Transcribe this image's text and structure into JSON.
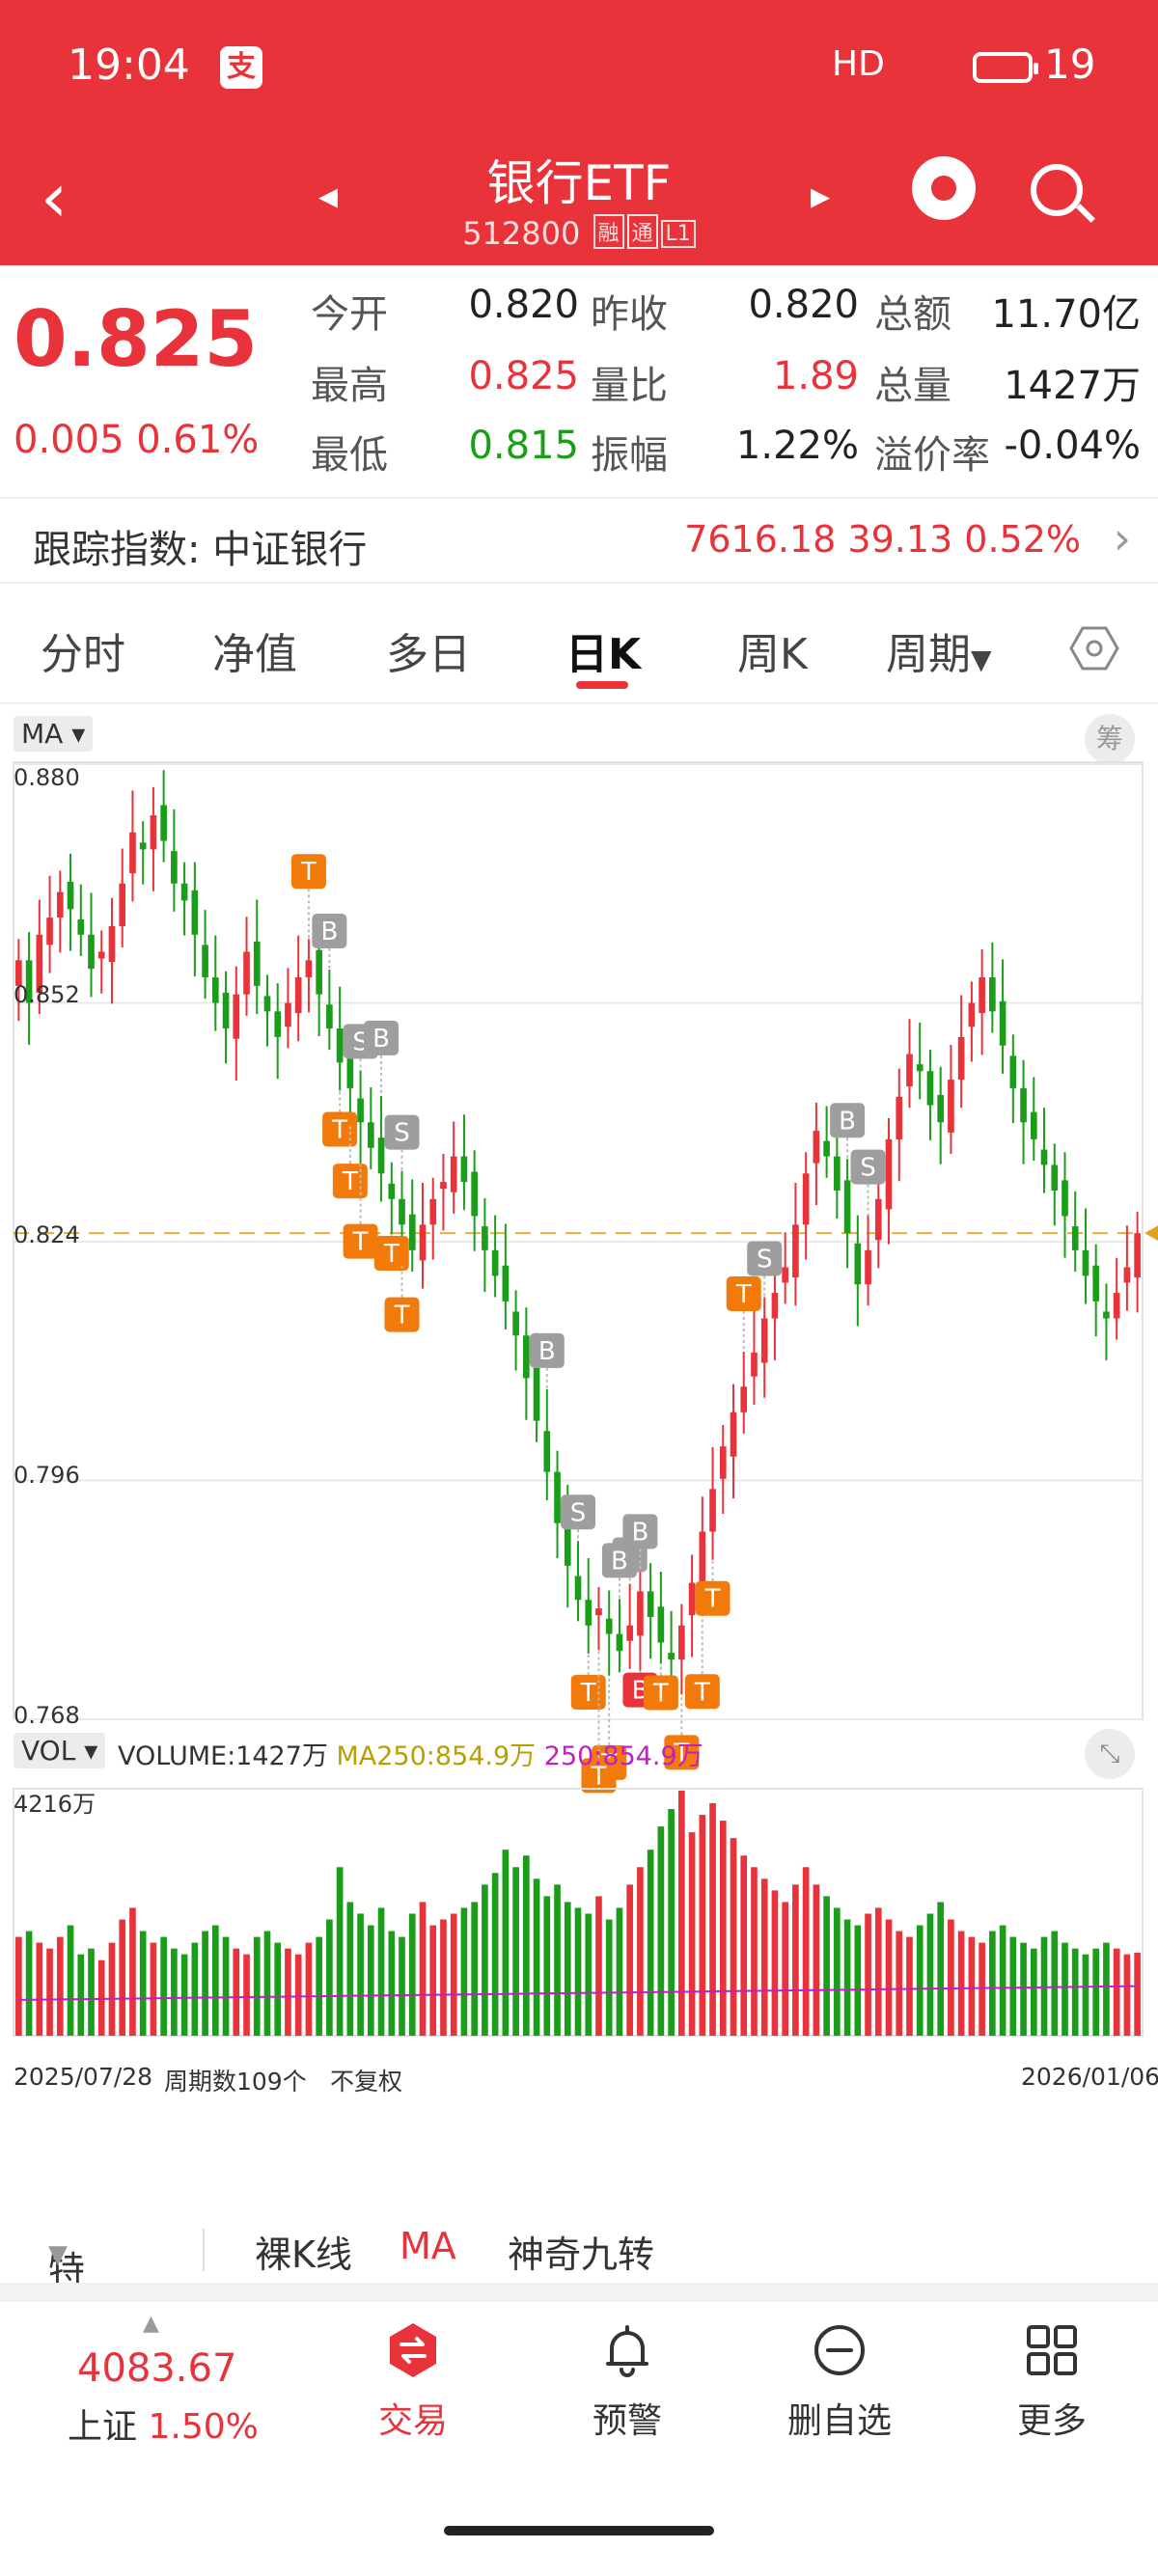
{
  "status": {
    "time": "19:04",
    "pay_icon": "支",
    "signal": "HD",
    "battery": "19"
  },
  "header": {
    "title": "银行ETF",
    "code": "512800",
    "tags": [
      "融",
      "通",
      "L1"
    ]
  },
  "quote": {
    "price": "0.825",
    "change": "0.005",
    "change_pct": "0.61%",
    "rows": [
      [
        {
          "label": "今开",
          "value": "0.820",
          "color": "#222"
        },
        {
          "label": "昨收",
          "value": "0.820",
          "color": "#222"
        },
        {
          "label": "总额",
          "value": "11.70亿",
          "color": "#222"
        }
      ],
      [
        {
          "label": "最高",
          "value": "0.825",
          "color": "#e8333a"
        },
        {
          "label": "量比",
          "value": "1.89",
          "color": "#e8333a"
        },
        {
          "label": "总量",
          "value": "1427万",
          "color": "#222"
        }
      ],
      [
        {
          "label": "最低",
          "value": "0.815",
          "color": "#1a9e1a"
        },
        {
          "label": "振幅",
          "value": "1.22%",
          "color": "#222"
        },
        {
          "label": "溢价率",
          "value": "-0.04%",
          "color": "#222"
        }
      ]
    ]
  },
  "tracking": {
    "label": "跟踪指数: 中证银行",
    "value": "7616.18  39.13  0.52%"
  },
  "tabs": [
    "分时",
    "净值",
    "多日",
    "日K",
    "周K",
    "周期"
  ],
  "active_tab": "日K",
  "chart": {
    "indicator": "MA",
    "chou_label": "筹",
    "y_ticks": [
      "0.880",
      "0.852",
      "0.824",
      "0.796",
      "0.768"
    ],
    "y_tick_values": [
      0.88,
      0.852,
      0.824,
      0.796,
      0.768
    ],
    "ref_price": 0.825,
    "vol_indicator": "VOL",
    "vol_legend": {
      "volume": "VOLUME:1427万",
      "ma250": "MA250:854.9万",
      "ma250b": "250:854.9万"
    },
    "vol_max": "4216万",
    "x_start": "2025/07/28",
    "periods": "周期数109个",
    "adjust": "不复权",
    "x_end": "2026/01/06"
  },
  "chart_data": {
    "type": "candlestick",
    "x_range": [
      "2025/07/28",
      "2026/01/06"
    ],
    "periods": 109,
    "ylim": [
      0.768,
      0.88
    ],
    "closes": [
      0.857,
      0.852,
      0.86,
      0.862,
      0.865,
      0.863,
      0.86,
      0.856,
      0.858,
      0.861,
      0.866,
      0.872,
      0.87,
      0.874,
      0.871,
      0.866,
      0.864,
      0.86,
      0.855,
      0.852,
      0.849,
      0.853,
      0.858,
      0.854,
      0.851,
      0.848,
      0.852,
      0.855,
      0.857,
      0.853,
      0.849,
      0.845,
      0.842,
      0.838,
      0.835,
      0.832,
      0.829,
      0.826,
      0.823,
      0.826,
      0.829,
      0.831,
      0.834,
      0.831,
      0.827,
      0.823,
      0.82,
      0.817,
      0.813,
      0.808,
      0.803,
      0.797,
      0.791,
      0.786,
      0.782,
      0.779,
      0.781,
      0.778,
      0.776,
      0.779,
      0.783,
      0.78,
      0.777,
      0.775,
      0.779,
      0.784,
      0.79,
      0.795,
      0.8,
      0.804,
      0.807,
      0.811,
      0.815,
      0.818,
      0.821,
      0.826,
      0.832,
      0.837,
      0.834,
      0.83,
      0.825,
      0.819,
      0.823,
      0.829,
      0.836,
      0.841,
      0.846,
      0.844,
      0.84,
      0.838,
      0.843,
      0.848,
      0.852,
      0.855,
      0.851,
      0.847,
      0.842,
      0.838,
      0.836,
      0.833,
      0.83,
      0.827,
      0.823,
      0.82,
      0.817,
      0.815,
      0.818,
      0.821,
      0.825
    ],
    "volumes_wan": [
      1700,
      1800,
      1600,
      1500,
      1700,
      1900,
      1400,
      1500,
      1300,
      1600,
      2000,
      2200,
      1800,
      1600,
      1700,
      1500,
      1400,
      1600,
      1800,
      1900,
      1700,
      1500,
      1400,
      1700,
      1800,
      1600,
      1500,
      1400,
      1600,
      1700,
      2000,
      2900,
      2300,
      2100,
      1900,
      2200,
      1800,
      1700,
      2100,
      2300,
      1900,
      2000,
      2100,
      2200,
      2300,
      2600,
      2800,
      3200,
      2900,
      3100,
      2700,
      2400,
      2600,
      2300,
      2200,
      2100,
      2400,
      2000,
      2200,
      2600,
      2900,
      3200,
      3600,
      3900,
      4216,
      3500,
      3800,
      4000,
      3700,
      3400,
      3100,
      2900,
      2700,
      2500,
      2300,
      2600,
      2900,
      2600,
      2400,
      2200,
      2000,
      1900,
      2100,
      2200,
      2000,
      1800,
      1700,
      1900,
      2100,
      2300,
      2000,
      1800,
      1700,
      1600,
      1800,
      1900,
      1700,
      1600,
      1500,
      1700,
      1800,
      1600,
      1500,
      1400,
      1500,
      1600,
      1500,
      1400,
      1427
    ],
    "markers": [
      {
        "label": "T",
        "color": "#f27a0a"
      },
      {
        "label": "B",
        "color": "#9e9e9e"
      },
      {
        "label": "S",
        "color": "#9e9e9e"
      },
      {
        "label": "B",
        "color": "#9e9e9e"
      },
      {
        "label": "S",
        "color": "#9e9e9e"
      },
      {
        "label": "T",
        "color": "#f27a0a"
      },
      {
        "label": "T",
        "color": "#f27a0a"
      },
      {
        "label": "T",
        "color": "#f27a0a"
      },
      {
        "label": "T",
        "color": "#f27a0a"
      },
      {
        "label": "T",
        "color": "#f27a0a"
      },
      {
        "label": "B",
        "color": "#9e9e9e"
      },
      {
        "label": "S",
        "color": "#9e9e9e"
      },
      {
        "label": "S",
        "color": "#9e9e9e"
      },
      {
        "label": "B",
        "color": "#9e9e9e"
      },
      {
        "label": "B",
        "color": "#e8333a"
      },
      {
        "label": "T",
        "color": "#f27a0a"
      },
      {
        "label": "T",
        "color": "#f27a0a"
      },
      {
        "label": "T",
        "color": "#f27a0a"
      },
      {
        "label": "B",
        "color": "#9e9e9e"
      },
      {
        "label": "T",
        "color": "#f27a0a"
      },
      {
        "label": "T",
        "color": "#f27a0a"
      },
      {
        "label": "T",
        "color": "#f27a0a"
      },
      {
        "label": "T",
        "color": "#f27a0a"
      },
      {
        "label": "S",
        "color": "#9e9e9e"
      },
      {
        "label": "T",
        "color": "#f27a0a"
      },
      {
        "label": "B",
        "color": "#9e9e9e"
      },
      {
        "label": "S",
        "color": "#9e9e9e"
      }
    ]
  },
  "subtabs": [
    "特色",
    "裸K线",
    "MA",
    "神奇九转"
  ],
  "bottom": {
    "index_value": "4083.67",
    "index_name": "上证",
    "index_pct": "1.50%",
    "nav": [
      {
        "label": "交易",
        "icon": "trade-icon"
      },
      {
        "label": "预警",
        "icon": "bell-icon"
      },
      {
        "label": "删自选",
        "icon": "remove-watchlist-icon"
      },
      {
        "label": "更多",
        "icon": "grid-icon"
      }
    ]
  },
  "colors": {
    "accent": "#e8333a",
    "up": "#e8333a",
    "down": "#1a9e1a",
    "t_marker": "#f27a0a",
    "bs_marker": "#9e9e9e",
    "ma250": "#b8a000",
    "ma250b": "#c020c0"
  }
}
